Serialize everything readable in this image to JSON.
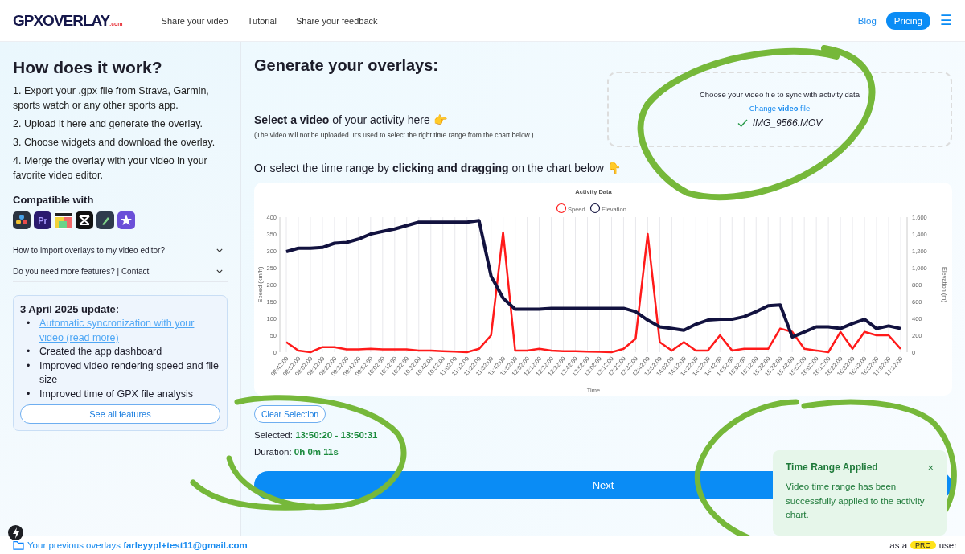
{
  "header": {
    "logo": {
      "name": "GPXOVERLAY",
      "suffix": ".com"
    },
    "nav": [
      "Share your video",
      "Tutorial",
      "Share your feedback"
    ],
    "blog": "Blog",
    "pricing": "Pricing",
    "menu_icon": "☰"
  },
  "sidebar": {
    "title": "How does it work?",
    "steps": [
      "1. Export your .gpx file from Strava, Garmin, sports watch or any other sports app.",
      "2. Upload it here and generate the overlay.",
      "3. Choose widgets and download the overlay.",
      "4. Merge the overlay with your video in your favorite video editor."
    ],
    "compatible_title": "Compatible with",
    "app_icons": [
      {
        "kind": "resolve"
      },
      {
        "kind": "premiere",
        "label": "Pr"
      },
      {
        "kind": "clapper"
      },
      {
        "kind": "capcut"
      },
      {
        "kind": "filmora"
      },
      {
        "kind": "imovie"
      }
    ],
    "accordion": [
      {
        "label": "How to import overlays to my video editor?",
        "expanded": false
      },
      {
        "label": "Do you need more features? | Contact",
        "expanded": false
      }
    ],
    "update": {
      "title": "3 April 2025 update:",
      "items": [
        {
          "kind": "link",
          "bullet": "•",
          "text": "Automatic syncronization with your video (read more)"
        },
        {
          "kind": "text",
          "bullet": "•",
          "text": "Created the app dashboard"
        },
        {
          "kind": "text",
          "bullet": "•",
          "text": "Improved video rendering speed and file size"
        },
        {
          "kind": "text",
          "bullet": "•",
          "text": "Improved time of GPX file analysis"
        }
      ],
      "button": "See all features"
    }
  },
  "main": {
    "title": "Generate your overlays:",
    "select_video": "**Select a video** of your activity here 👉",
    "note": "(The video will not be uploaded. It's used to select the right time range from the chart below.)",
    "file_box": {
      "prompt": "Choose your video file to sync with activity data",
      "change_link": "Change **video** file",
      "file_name": "IMG_9566.MOV"
    },
    "range_hint": "Or select the time range by **clicking and dragging** on the chart below 👇",
    "chart_data": {
      "type": "line",
      "title": "Activity Data",
      "xlabel": "Time",
      "ylabel": "Speed (km/h)",
      "y2label": "Elevation (m)",
      "categories": [
        "08:42:00",
        "08:52:00",
        "09:02:00",
        "09:12:00",
        "09:22:00",
        "09:32:00",
        "09:42:00",
        "09:52:00",
        "10:02:00",
        "10:12:00",
        "10:22:00",
        "10:32:00",
        "10:42:00",
        "10:52:00",
        "11:02:00",
        "11:12:00",
        "11:22:00",
        "11:32:00",
        "11:42:00",
        "11:52:00",
        "12:02:00",
        "12:12:00",
        "12:22:00",
        "12:32:00",
        "12:42:00",
        "12:52:00",
        "13:02:00",
        "13:12:00",
        "13:22:00",
        "13:32:00",
        "13:42:00",
        "13:52:00",
        "14:02:00",
        "14:12:00",
        "14:22:00",
        "14:32:00",
        "14:42:00",
        "14:52:00",
        "15:02:00",
        "15:12:00",
        "15:22:00",
        "15:32:00",
        "15:42:00",
        "15:52:00",
        "16:02:00",
        "16:12:00",
        "16:22:00",
        "16:32:00",
        "16:42:00",
        "16:52:00",
        "17:02:00",
        "17:12:00"
      ],
      "series": [
        {
          "name": "Speed",
          "color": "#ff1a1a",
          "values": [
            30,
            5,
            0,
            15,
            15,
            8,
            8,
            10,
            8,
            8,
            8,
            5,
            5,
            3,
            2,
            0,
            10,
            50,
            355,
            5,
            5,
            10,
            5,
            3,
            3,
            2,
            1,
            0,
            10,
            40,
            350,
            30,
            5,
            30,
            5,
            5,
            50,
            5,
            10,
            10,
            10,
            70,
            60,
            10,
            5,
            0,
            60,
            10,
            60,
            50,
            50,
            10
          ]
        },
        {
          "name": "Elevation",
          "color": "#12123f",
          "axis": "y2",
          "values": [
            1190,
            1230,
            1230,
            1240,
            1290,
            1300,
            1340,
            1400,
            1430,
            1460,
            1500,
            1540,
            1540,
            1540,
            1540,
            1540,
            1560,
            900,
            640,
            510,
            510,
            510,
            520,
            520,
            520,
            520,
            520,
            520,
            520,
            480,
            380,
            300,
            280,
            260,
            330,
            380,
            390,
            390,
            420,
            480,
            550,
            560,
            180,
            240,
            300,
            300,
            280,
            340,
            390,
            280,
            310,
            280
          ]
        }
      ],
      "grid": true,
      "legend": true,
      "ylim": [
        0,
        400
      ],
      "yticks": [
        0,
        50,
        100,
        150,
        200,
        250,
        300,
        350,
        400
      ],
      "y2lim": [
        0,
        1600
      ],
      "y2ticks": [
        {
          "value": 0,
          "label": "0"
        },
        {
          "value": 200,
          "label": "200"
        },
        {
          "value": 400,
          "label": "400"
        },
        {
          "value": 600,
          "label": "600"
        },
        {
          "value": 800,
          "label": "800"
        },
        {
          "value": 1000,
          "label": "1,000"
        },
        {
          "value": 1200,
          "label": "1,200"
        },
        {
          "value": 1400,
          "label": "1,400"
        },
        {
          "value": 1600,
          "label": "1,600"
        }
      ]
    },
    "clear_button": "Clear Selection",
    "selected_label": "Selected:",
    "selected_value": "13:50:20 - 13:50:31",
    "duration_label": "Duration:",
    "duration_value": "0h 0m 11s",
    "next_button": "Next"
  },
  "footer": {
    "previous": "Your previous overlays",
    "email": "farleyypl+test11@gmail.com",
    "status": "as a",
    "badge": "PRO",
    "status_end": "user"
  },
  "toast": {
    "title": "Time Range Applied",
    "close": "×",
    "message": "Video time range has been successfully applied to the activity chart."
  }
}
